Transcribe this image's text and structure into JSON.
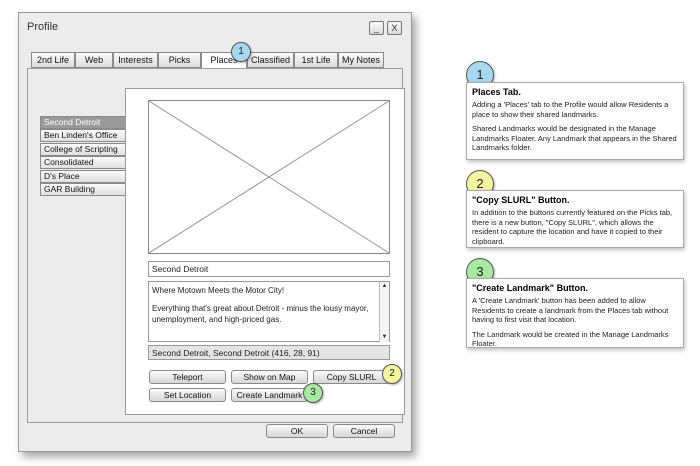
{
  "window": {
    "title": "Profile",
    "minimize_label": "_",
    "close_label": "X",
    "ok_label": "OK",
    "cancel_label": "Cancel"
  },
  "tabs": [
    "2nd Life",
    "Web",
    "Interests",
    "Picks",
    "Places",
    "Classified",
    "1st Life",
    "My Notes"
  ],
  "active_tab": "Places",
  "landmarks": [
    "Second Detroit",
    "Ben Linden's Office",
    "College of Scripting",
    "Consolidated",
    "D's Place",
    "GAR Building"
  ],
  "selected_landmark": "Second Detroit",
  "place": {
    "name": "Second Detroit",
    "description_line1": "Where Motown Meets the Motor City!",
    "description_line2": "Everything that's great about Detroit - minus the lousy mayor, unemployment, and high-priced gas.",
    "location": "Second Detroit, Second Detroit (416, 28, 91)"
  },
  "buttons": {
    "teleport": "Teleport",
    "show_on_map": "Show on Map",
    "copy_slurl": "Copy SLURL",
    "set_location": "Set Location",
    "create_landmark": "Create Landmark"
  },
  "callouts": {
    "c1": "1",
    "c2": "2",
    "c3": "3",
    "colors": {
      "c1": "#a8d8f0",
      "c2": "#f6f4a0",
      "c3": "#a8e8a0"
    }
  },
  "notes": [
    {
      "number": "1",
      "title": "Places Tab.",
      "body1": "Adding a 'Places' tab to the Profile would allow Residents a place to show their shared landmarks.",
      "body2": "Shared Landmarks would be designated in the Manage Landmarks Floater. Any Landmark that appears in the Shared Landmarks folder."
    },
    {
      "number": "2",
      "title": "\"Copy SLURL\" Button.",
      "body1": "In addition to the buttons currently featured on the Picks tab, there is a new button, \"Copy SLURL\", which allows the resident to capture the location and have it copied to their clipboard.",
      "body2": ""
    },
    {
      "number": "3",
      "title": "\"Create Landmark\" Button.",
      "body1": "A 'Create Landmark' button has been added to allow Residents to create a landmark from the Places tab without having to first visit that location.",
      "body2": "The Landmark would be created in the Manage Landmarks Floater."
    }
  ]
}
